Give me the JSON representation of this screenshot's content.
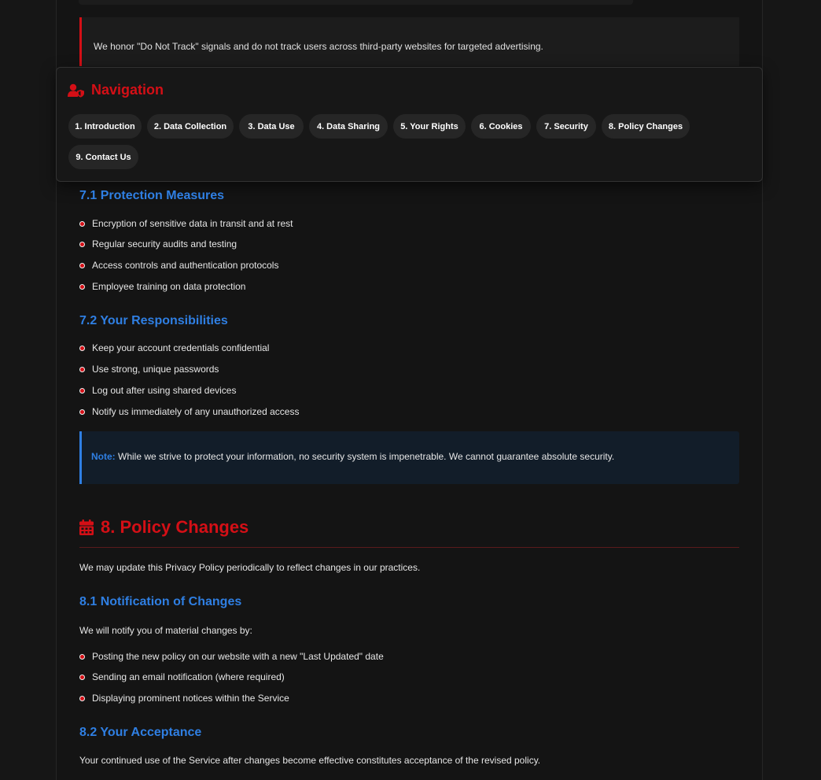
{
  "dnt_notice": "We honor \"Do Not Track\" signals and do not track users across third-party websites for targeted advertising.",
  "navigation": {
    "title": "Navigation",
    "items": [
      {
        "label": "1. Introduction"
      },
      {
        "label": "2. Data Collection"
      },
      {
        "label": "3. Data Use"
      },
      {
        "label": "4. Data Sharing"
      },
      {
        "label": "5. Your Rights"
      },
      {
        "label": "6. Cookies"
      },
      {
        "label": "7. Security"
      },
      {
        "label": "8. Policy Changes"
      },
      {
        "label": "9. Contact Us"
      }
    ]
  },
  "security": {
    "protection_title": "7.1 Protection Measures",
    "protection_items": [
      "Encryption of sensitive data in transit and at rest",
      "Regular security audits and testing",
      "Access controls and authentication protocols",
      "Employee training on data protection"
    ],
    "responsibilities_title": "7.2 Your Responsibilities",
    "responsibilities_items": [
      "Keep your account credentials confidential",
      "Use strong, unique passwords",
      "Log out after using shared devices",
      "Notify us immediately of any unauthorized access"
    ],
    "note_label": "Note:",
    "note_text": " While we strive to protect your information, no security system is impenetrable. We cannot guarantee absolute security."
  },
  "policy_changes": {
    "title": "8. Policy Changes",
    "intro": "We may update this Privacy Policy periodically to reflect changes in our practices.",
    "notification_title": "8.1 Notification of Changes",
    "notification_intro": "We will notify you of material changes by:",
    "notification_items": [
      "Posting the new policy on our website with a new \"Last Updated\" date",
      "Sending an email notification (where required)",
      "Displaying prominent notices within the Service"
    ],
    "acceptance_title": "8.2 Your Acceptance",
    "acceptance_text": "Your continued use of the Service after changes become effective constitutes acceptance of the revised policy."
  },
  "colors": {
    "accent_red": "#d40f16",
    "accent_blue": "#2f7fe3",
    "background": "#141414"
  }
}
